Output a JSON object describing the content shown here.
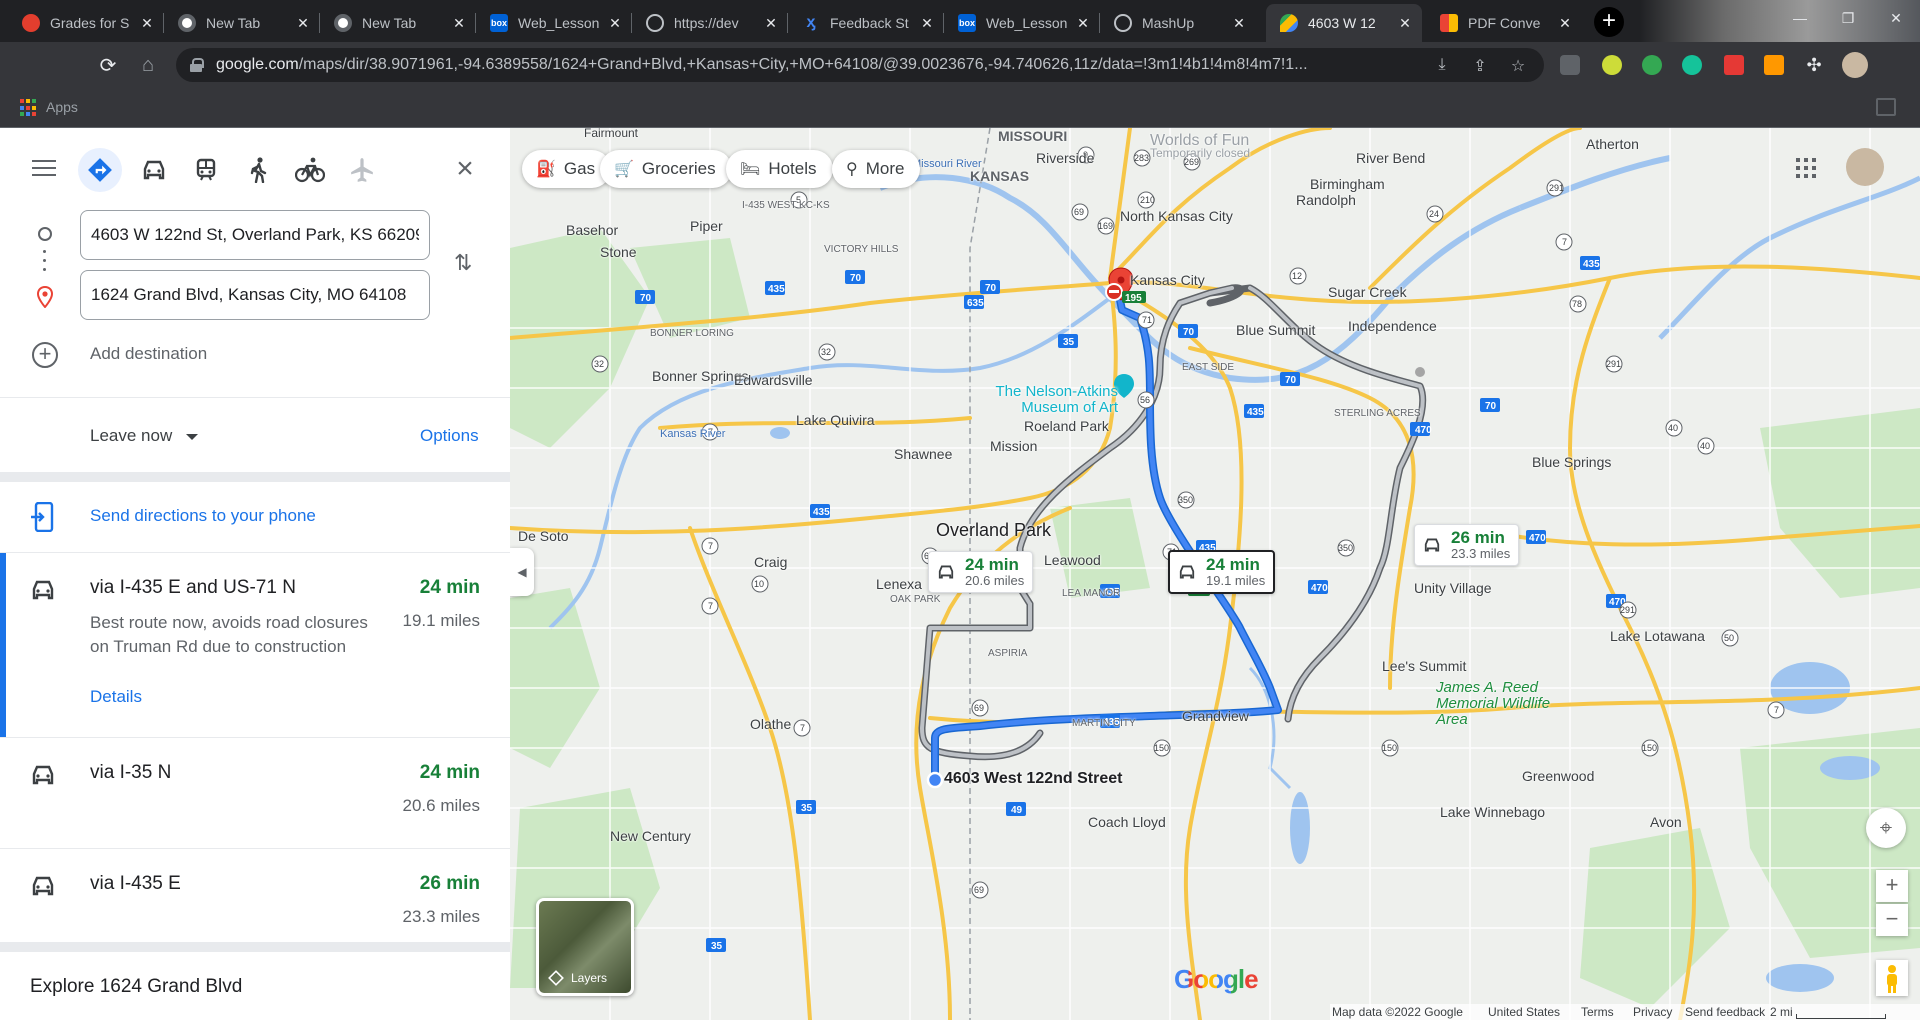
{
  "browser": {
    "tabs": [
      {
        "label": "Grades for S",
        "icon": "canvas-icon",
        "color": "#e33e2e"
      },
      {
        "label": "New Tab",
        "icon": "chrome-icon",
        "color": "#fff"
      },
      {
        "label": "New Tab",
        "icon": "chrome-icon",
        "color": "#fff"
      },
      {
        "label": "Web_Lesson",
        "icon": "box-icon",
        "color": "#0061d5"
      },
      {
        "label": "https://dev",
        "icon": "globe-icon",
        "color": "#bdc1c6"
      },
      {
        "label": "Feedback St",
        "icon": "feedback-icon",
        "color": "#4285f4"
      },
      {
        "label": "Web_Lesson",
        "icon": "box-icon",
        "color": "#0061d5"
      },
      {
        "label": "MashUp",
        "icon": "globe-icon",
        "color": "#bdc1c6"
      },
      {
        "label": "4603 W 12",
        "icon": "maps-icon",
        "color": "#34a853"
      },
      {
        "label": "PDF Conve",
        "icon": "pdf-icon",
        "color": "#ff9800"
      }
    ],
    "url_host": "google.com",
    "url_path": "/maps/dir/38.9071961,-94.6389558/1624+Grand+Blvd,+Kansas+City,+MO+64108/@39.0023676,-94.740626,11z/data=!3m1!4b1!4m8!4m7!1...",
    "bookmarks_label": "Apps"
  },
  "panel": {
    "origin": "4603 W 122nd St, Overland Park, KS 66209",
    "destination": "1624 Grand Blvd, Kansas City, MO 64108",
    "add_destination": "Add destination",
    "leave_now": "Leave now",
    "options": "Options",
    "send_directions": "Send directions to your phone",
    "routes": [
      {
        "name": "via I-435 E and US-71 N",
        "time": "24 min",
        "distance": "19.1 miles",
        "desc": "Best route now, avoids road closures on Truman Rd due to construction",
        "details": "Details"
      },
      {
        "name": "via I-35 N",
        "time": "24 min",
        "distance": "20.6 miles"
      },
      {
        "name": "via I-435 E",
        "time": "26 min",
        "distance": "23.3 miles"
      }
    ],
    "explore": "Explore 1624 Grand Blvd"
  },
  "map": {
    "chips": [
      {
        "label": "Gas",
        "icon": "gas-station-icon"
      },
      {
        "label": "Groceries",
        "icon": "cart-icon"
      },
      {
        "label": "Hotels",
        "icon": "bed-icon"
      },
      {
        "label": "More",
        "icon": "search-icon"
      }
    ],
    "bubbles": [
      {
        "time": "24 min",
        "distance": "20.6 miles"
      },
      {
        "time": "24 min",
        "distance": "19.1 miles"
      },
      {
        "time": "26 min",
        "distance": "23.3 miles"
      }
    ],
    "origin_label": "4603 West 122nd Street",
    "poi": "The Nelson-Atkins Museum of Art",
    "layers_label": "Layers",
    "google_logo": "Google",
    "footer": {
      "data": "Map data ©2022 Google",
      "country": "United States",
      "terms": "Terms",
      "privacy": "Privacy",
      "feedback": "Send feedback",
      "scale": "2 mi"
    },
    "places": [
      "Fairmount",
      "Riverside",
      "Worlds of Fun",
      "Temporarily closed",
      "River Bend",
      "Atherton",
      "Birmingham",
      "Randolph",
      "North Kansas City",
      "Basehor",
      "Piper",
      "Stone",
      "VICTORY HILLS",
      "Kansas City",
      "Sugar Creek",
      "Independence",
      "Blue Summit",
      "BONNER LORING",
      "Bonner Springs",
      "Edwardsville",
      "EAST SIDE",
      "STERLING ACRES",
      "Lake Quivira",
      "Roeland Park",
      "Mission",
      "Shawnee",
      "Blue Springs",
      "De Soto",
      "Overland Park",
      "Leawood",
      "Craig",
      "Lenexa",
      "OAK PARK",
      "LEA MANOR",
      "Unity Village",
      "ASPIRIA",
      "Lee's Summit",
      "Lake Lotawana",
      "Olathe",
      "Grandview",
      "MARTIN CITY",
      "Greenwood",
      "New Century",
      "Coach Lloyd",
      "Lake Winnebago",
      "Avon",
      "MISSOURI",
      "KANSAS",
      "I-435 WEST KC-KS",
      "Missouri River",
      "Kansas River",
      "James A. Reed Memorial Wildlife Area"
    ]
  }
}
